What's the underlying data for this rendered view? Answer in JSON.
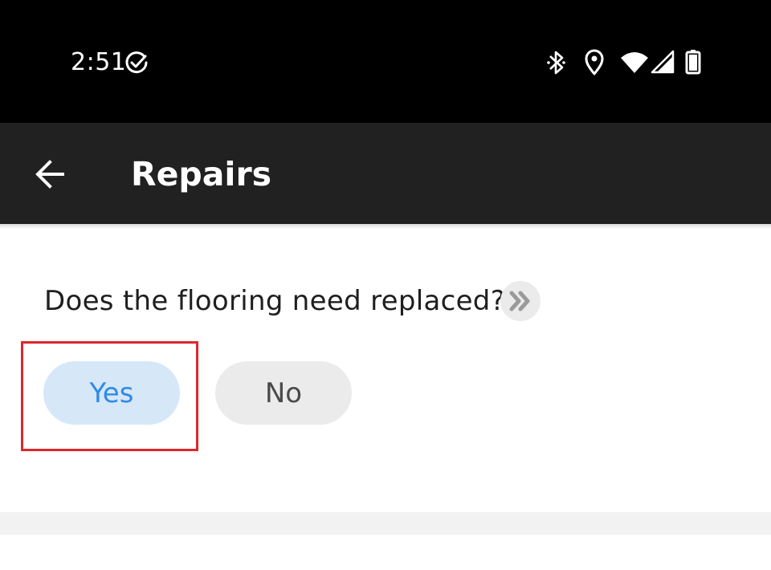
{
  "status_bar": {
    "time": "2:51",
    "icons": [
      "check-circle-icon",
      "bluetooth-icon",
      "location-icon",
      "wifi-icon",
      "signal-icon",
      "battery-icon"
    ]
  },
  "app_bar": {
    "back_icon": "arrow-left-icon",
    "title": "Repairs"
  },
  "question": {
    "text": "Does the flooring need replaced?",
    "skip_icon": "double-chevron-right-icon"
  },
  "choices": {
    "yes_label": "Yes",
    "no_label": "No",
    "selected": "Yes"
  },
  "colors": {
    "status_bar_bg": "#000000",
    "app_bar_bg": "#212121",
    "yes_bg": "#d6e7f8",
    "yes_text": "#2f8ae6",
    "no_bg": "#ebebeb",
    "highlight": "#e0262b"
  }
}
